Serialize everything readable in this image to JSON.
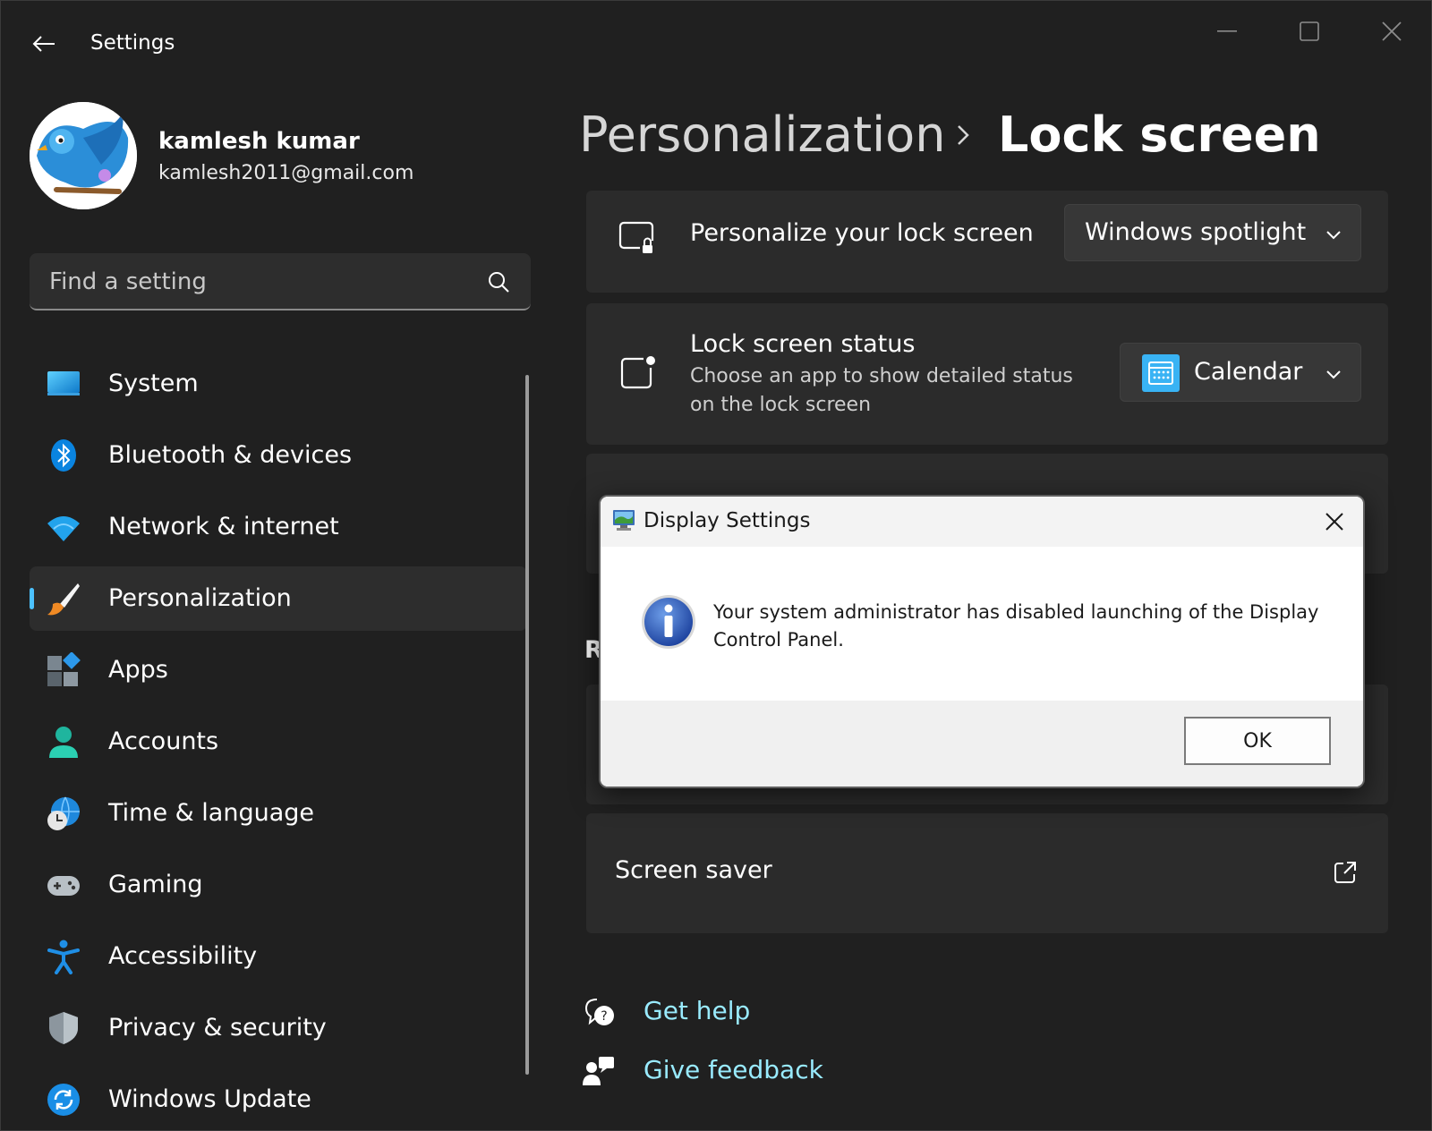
{
  "window": {
    "title": "Settings",
    "controls": {
      "minimize": "minimize",
      "maximize": "maximize",
      "close": "close"
    }
  },
  "profile": {
    "name": "kamlesh kumar",
    "email": "kamlesh2011@gmail.com"
  },
  "search": {
    "placeholder": "Find a setting"
  },
  "nav": {
    "items": [
      {
        "label": "System",
        "icon": "system-icon"
      },
      {
        "label": "Bluetooth & devices",
        "icon": "bluetooth-icon"
      },
      {
        "label": "Network & internet",
        "icon": "wifi-icon"
      },
      {
        "label": "Personalization",
        "icon": "brush-icon",
        "selected": true
      },
      {
        "label": "Apps",
        "icon": "apps-icon"
      },
      {
        "label": "Accounts",
        "icon": "accounts-icon"
      },
      {
        "label": "Time & language",
        "icon": "globe-clock-icon"
      },
      {
        "label": "Gaming",
        "icon": "gamepad-icon"
      },
      {
        "label": "Accessibility",
        "icon": "accessibility-icon"
      },
      {
        "label": "Privacy & security",
        "icon": "shield-icon"
      },
      {
        "label": "Windows Update",
        "icon": "update-icon"
      }
    ]
  },
  "breadcrumb": {
    "parent": "Personalization",
    "current": "Lock screen"
  },
  "cards": {
    "personalize": {
      "title": "Personalize your lock screen",
      "dropdown_value": "Windows spotlight"
    },
    "status": {
      "title": "Lock screen status",
      "description": "Choose an app to show detailed status on the lock screen",
      "dropdown_value": "Calendar"
    },
    "section_letter": "R",
    "screen_saver": {
      "title": "Screen saver"
    }
  },
  "links": {
    "help": "Get help",
    "feedback": "Give feedback"
  },
  "dialog": {
    "title": "Display Settings",
    "message": "Your system administrator has disabled launching of the Display Control Panel.",
    "ok_label": "OK"
  },
  "colors": {
    "background": "#202020",
    "card": "#2b2b2b",
    "accent": "#4cc2ff",
    "link": "#99ebff"
  }
}
